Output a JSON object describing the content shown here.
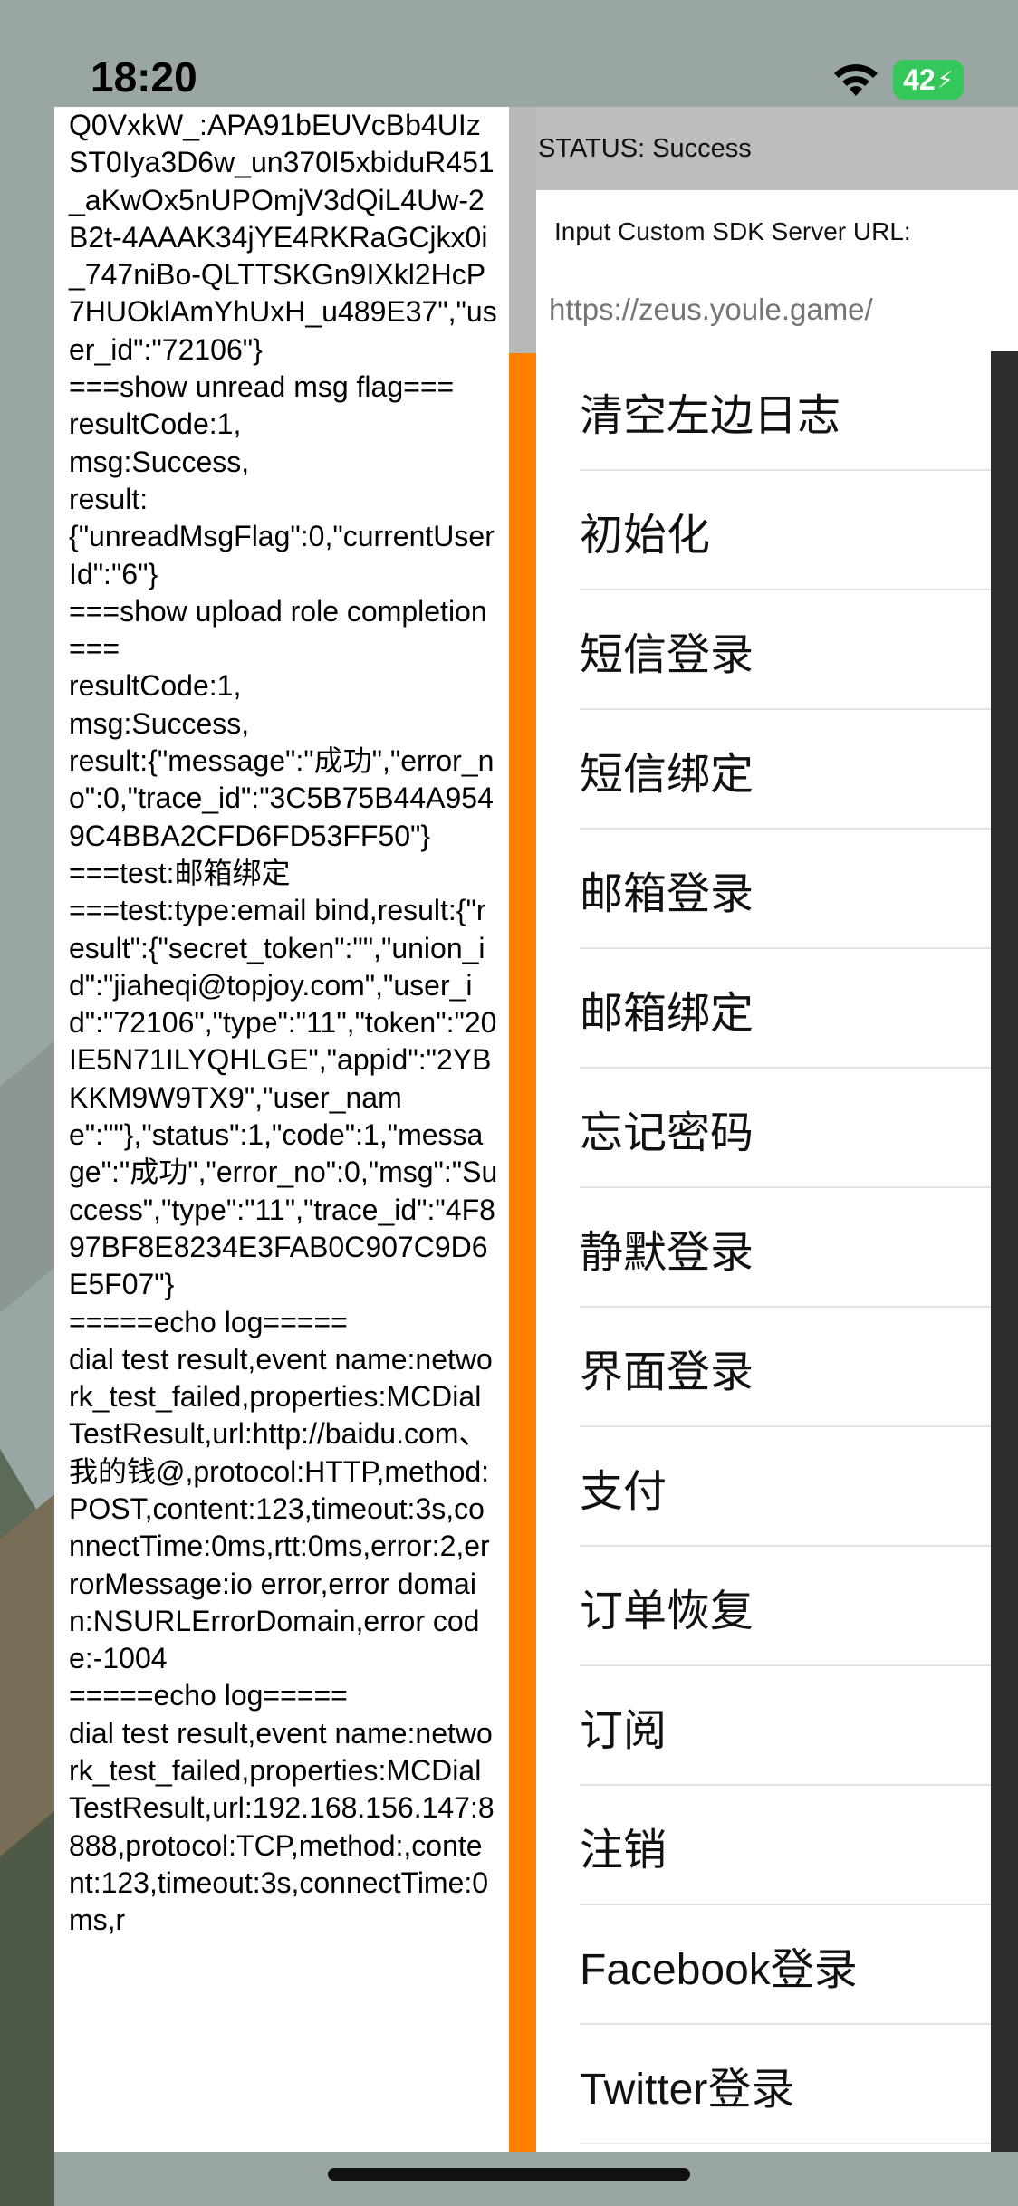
{
  "status_bar": {
    "time": "18:20",
    "battery": "42",
    "wifi_icon": "wifi-icon",
    "battery_icon": "battery-charging-icon"
  },
  "log": {
    "text": "Q0VxkW_:APA91bEUVcBb4UIzST0Iya3D6w_un370I5xbiduR451_aKwOx5nUPOmjV3dQiL4Uw-2B2t-4AAAK34jYE4RKRaGCjkx0i_747niBo-QLTTSKGn9IXkl2HcP7HUOklAmYhUxH_u489E37\",\"user_id\":\"72106\"}\n===show unread msg flag===\nresultCode:1,\nmsg:Success,\nresult:\n{\"unreadMsgFlag\":0,\"currentUserId\":\"6\"}\n===show upload role completion===\nresultCode:1,\nmsg:Success,\nresult:{\"message\":\"成功\",\"error_no\":0,\"trace_id\":\"3C5B75B44A9549C4BBA2CFD6FD53FF50\"}\n===test:邮箱绑定\n===test:type:email bind,result:{\"result\":{\"secret_token\":\"\",\"union_id\":\"jiaheqi@topjoy.com\",\"user_id\":\"72106\",\"type\":\"11\",\"token\":\"20IE5N71ILYQHLGE\",\"appid\":\"2YBKKM9W9TX9\",\"user_name\":\"\"},\"status\":1,\"code\":1,\"message\":\"成功\",\"error_no\":0,\"msg\":\"Success\",\"type\":\"11\",\"trace_id\":\"4F897BF8E8234E3FAB0C907C9D6E5F07\"}\n=====echo log=====\ndial test result,event name:network_test_failed,properties:MCDialTestResult,url:http://baidu.com、我的钱@,protocol:HTTP,method:POST,content:123,timeout:3s,connectTime:0ms,rtt:0ms,error:2,errorMessage:io error,error domain:NSURLErrorDomain,error code:-1004\n=====echo log=====\ndial test result,event name:network_test_failed,properties:MCDialTestResult,url:192.168.156.147:8888,protocol:TCP,method:,content:123,timeout:3s,connectTime:0ms,r"
  },
  "header": {
    "status": "STATUS: Success",
    "url_label": "Input Custom SDK Server URL:",
    "url_placeholder": "https://zeus.youle.game/"
  },
  "menu": {
    "items": [
      {
        "label": "清空左边日志"
      },
      {
        "label": "初始化"
      },
      {
        "label": "短信登录"
      },
      {
        "label": "短信绑定"
      },
      {
        "label": "邮箱登录"
      },
      {
        "label": "邮箱绑定"
      },
      {
        "label": "忘记密码"
      },
      {
        "label": "静默登录"
      },
      {
        "label": "界面登录"
      },
      {
        "label": "支付"
      },
      {
        "label": "订单恢复"
      },
      {
        "label": "订阅"
      },
      {
        "label": "注销"
      },
      {
        "label": "Facebook登录"
      },
      {
        "label": "Twitter登录"
      }
    ]
  },
  "colors": {
    "accent_strip": "#ff7f00",
    "battery": "#34c759",
    "header_bg": "#bdbdbd"
  }
}
